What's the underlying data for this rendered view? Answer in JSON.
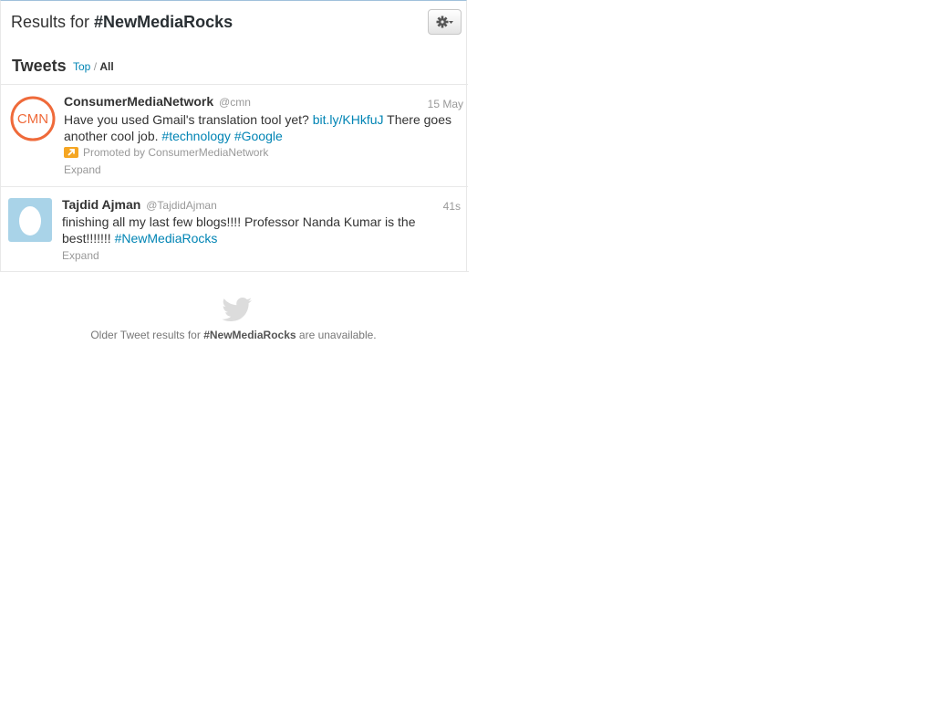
{
  "header": {
    "prefix": "Results for",
    "query": "#NewMediaRocks"
  },
  "settings": {
    "icon": "gear-icon",
    "caret": "caret-down-icon"
  },
  "tweets_section": {
    "title": "Tweets",
    "nav_top": "Top",
    "nav_sep": "/",
    "nav_all": "All"
  },
  "tweets": [
    {
      "avatar_text": "CMN",
      "name": "ConsumerMediaNetwork",
      "handle": "@cmn",
      "time": "15 May",
      "text_1": "Have you used Gmail's translation tool yet?",
      "link_1": "bit.ly/KHkfuJ",
      "text_2": "There goes another cool job.",
      "tag_1": "#technology",
      "tag_2": "#Google",
      "promoted": "Promoted by ConsumerMediaNetwork",
      "expand": "Expand"
    },
    {
      "name": "Tajdid Ajman",
      "handle": "@TajdidAjman",
      "time": "41s",
      "text_1": "finishing all my last few blogs!!!! Professor Nanda Kumar is the best!!!!!!!",
      "tag_1": "#NewMediaRocks",
      "expand": "Expand"
    }
  ],
  "footer": {
    "prefix": "Older Tweet results for",
    "query": "#NewMediaRocks",
    "suffix": "are unavailable."
  },
  "colors": {
    "link": "#0084b4",
    "muted": "#999999",
    "cmn_orange": "#ef6a3a",
    "promo": "#f5a623",
    "egg_bg": "#a9d3e8"
  }
}
